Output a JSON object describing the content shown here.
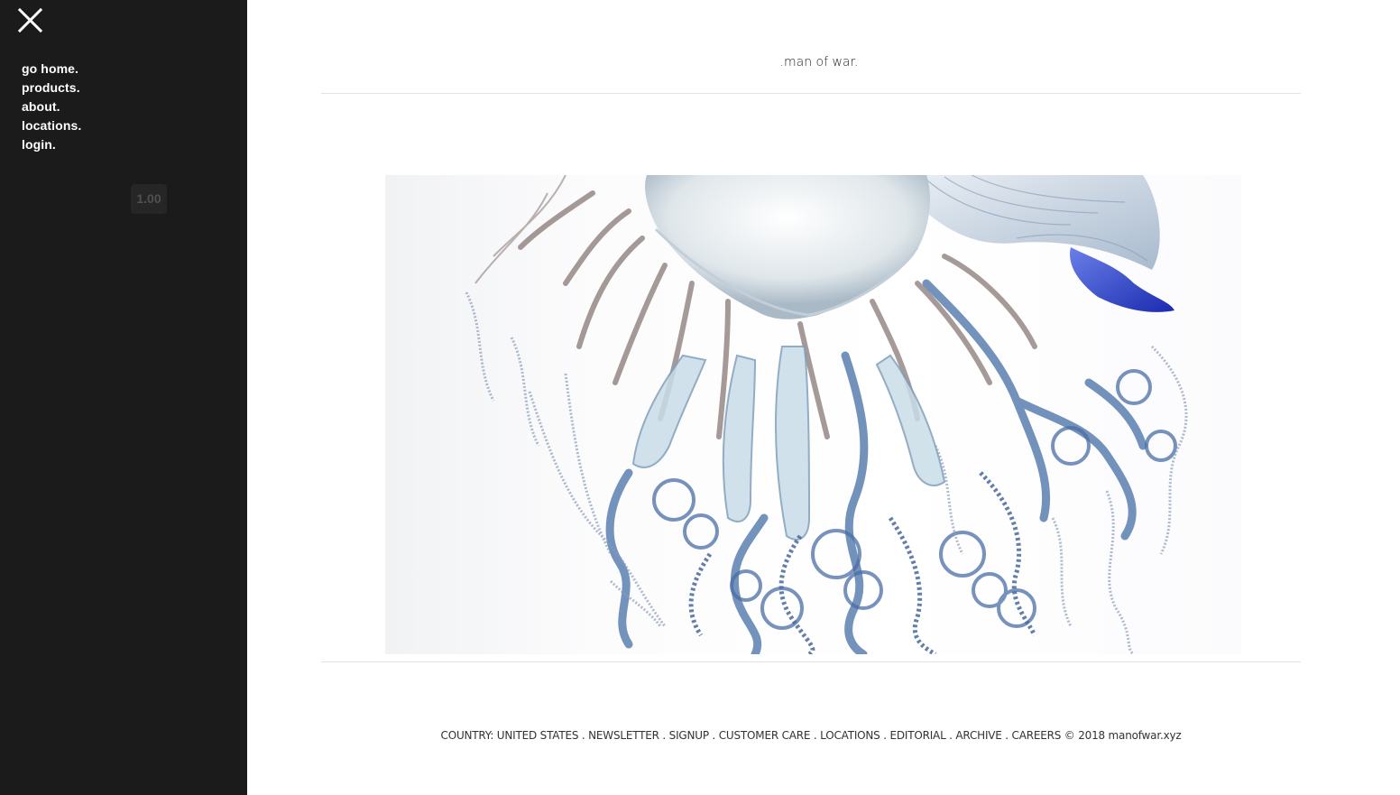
{
  "sidebar": {
    "close_icon": "close-icon",
    "nav_items": [
      {
        "label": "go home."
      },
      {
        "label": "products."
      },
      {
        "label": "about."
      },
      {
        "label": "locations."
      },
      {
        "label": "login."
      }
    ],
    "rate_badge": "1.00"
  },
  "header": {
    "site_title": ".man of war."
  },
  "hero": {
    "image_subject": "portuguese man o' war jellyfish",
    "colors": {
      "tentacle_blue": "#5a7fb0",
      "float_blue": "#2a3fc0",
      "brown": "#5e4a45"
    }
  },
  "footer": {
    "text": "COUNTRY: UNITED STATES . NEWSLETTER . SIGNUP . CUSTOMER CARE . LOCATIONS . EDITORIAL . ARCHIVE . CAREERS © 2018 manofwar.xyz"
  },
  "colors": {
    "sidebar_bg": "#1b1b1b",
    "page_bg": "#ffffff",
    "rule": "#e3e3e3"
  }
}
